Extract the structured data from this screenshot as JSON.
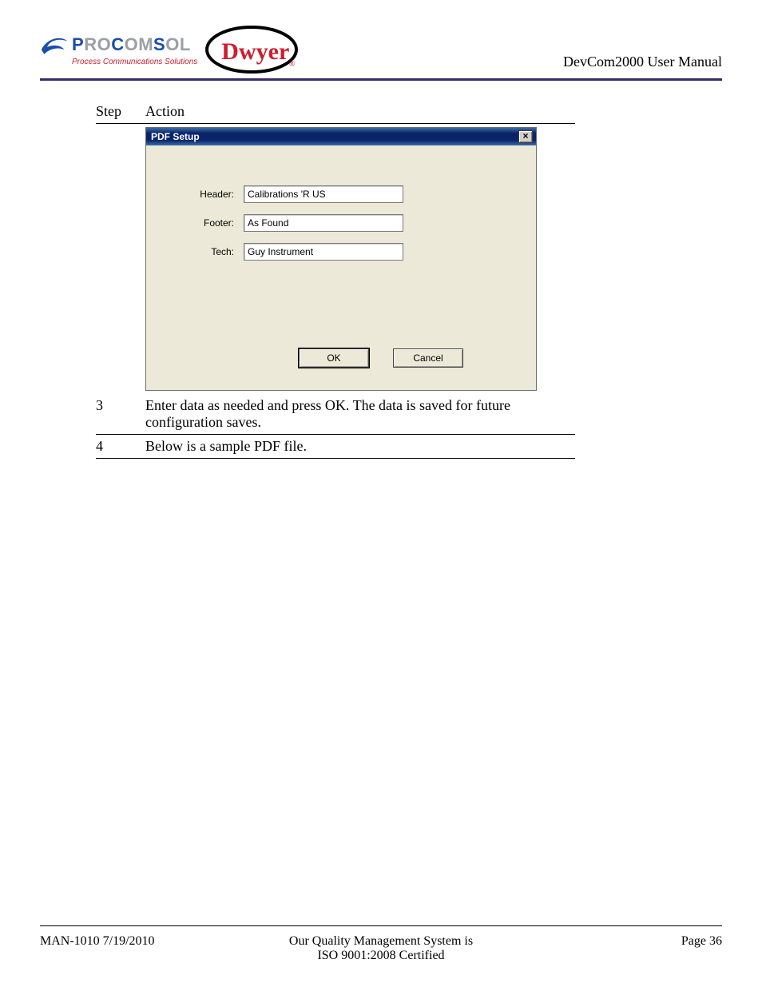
{
  "header": {
    "company_name_parts": {
      "pro": "P",
      "ro": "RO",
      "com": "C",
      "om": "OM",
      "sol": "S",
      "ol": "OL"
    },
    "tagline": "Process Communications Solutions",
    "dwyer": "Dwyer",
    "manual_title": "DevCom2000 User Manual"
  },
  "table_head": {
    "step": "Step",
    "action": "Action"
  },
  "dialog": {
    "title": "PDF Setup",
    "close_glyph": "×",
    "labels": {
      "header": "Header:",
      "footer": "Footer:",
      "tech": "Tech:"
    },
    "values": {
      "header": "Calibrations 'R US",
      "footer": "As Found",
      "tech": "Guy Instrument"
    },
    "buttons": {
      "ok": "OK",
      "cancel": "Cancel"
    }
  },
  "rows": {
    "r3_num": "3",
    "r3_text": "Enter data as needed and press OK.  The data is saved for future configuration saves.",
    "r4_num": "4",
    "r4_text": "Below is a sample PDF file."
  },
  "footer": {
    "left": "MAN-1010 7/19/2010",
    "center1": "Our Quality Management System is",
    "center2": "ISO 9001:2008 Certified",
    "right": "Page 36"
  }
}
